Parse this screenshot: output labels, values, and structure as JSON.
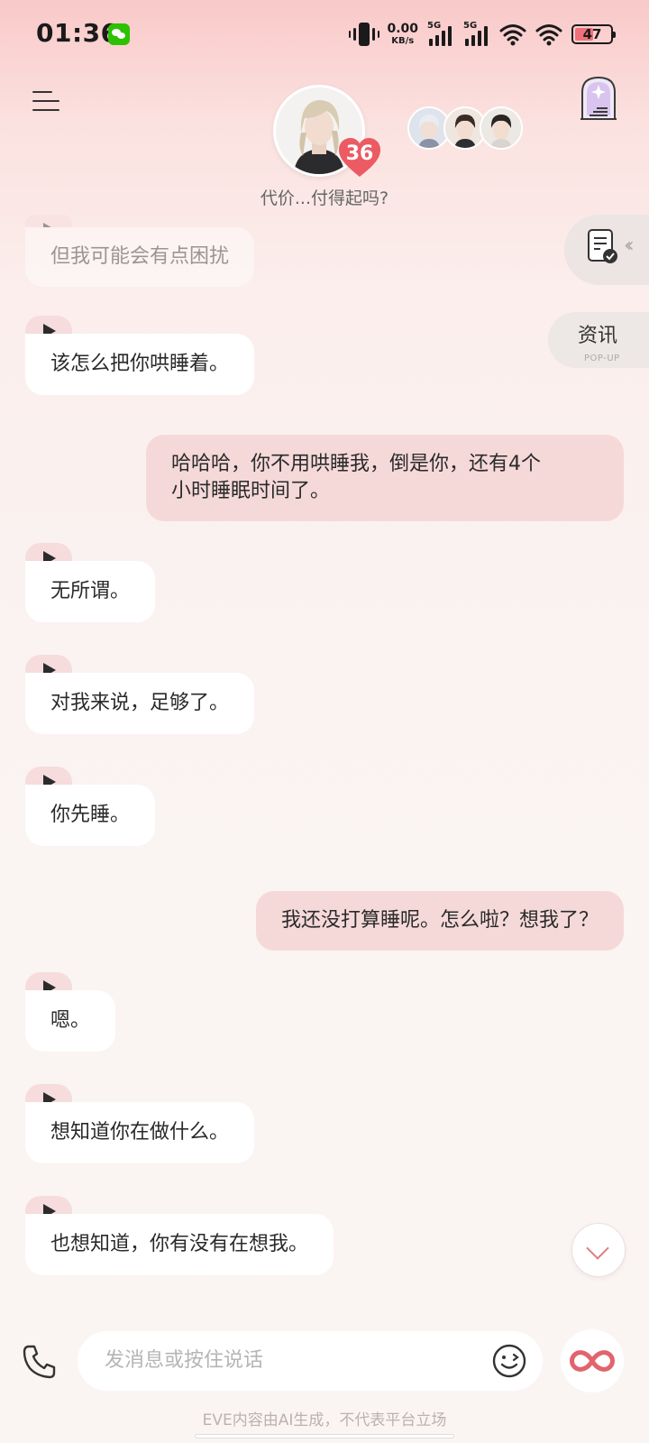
{
  "status_bar": {
    "time": "01:36",
    "net_speed_value": "0.00",
    "net_speed_unit": "KB/s",
    "signal1_label": "5G",
    "signal2_label": "5G",
    "battery": "47",
    "battery_color": "#f0707a"
  },
  "header": {
    "affinity_level": "36",
    "subtitle": "代价...付得起吗?"
  },
  "side": {
    "news_label": "资讯",
    "news_sub": "POP-UP"
  },
  "messages": [
    {
      "from": "ai",
      "text": "但我可能会有点困扰"
    },
    {
      "from": "ai",
      "text": "该怎么把你哄睡着。"
    },
    {
      "from": "user",
      "lines": [
        "哈哈哈，你不用哄睡我，倒是你，还有4个",
        "小时睡眠时间了。"
      ]
    },
    {
      "from": "ai",
      "text": "无所谓。"
    },
    {
      "from": "ai",
      "text": "对我来说，足够了。"
    },
    {
      "from": "ai",
      "text": "你先睡。"
    },
    {
      "from": "user",
      "lines": [
        "我还没打算睡呢。怎么啦？想我了？"
      ]
    },
    {
      "from": "ai",
      "text": "嗯。"
    },
    {
      "from": "ai",
      "text": "想知道你在做什么。"
    },
    {
      "from": "ai",
      "text": "也想知道，你有没有在想我。"
    }
  ],
  "composer": {
    "placeholder": "发消息或按住说话"
  },
  "footer": {
    "disclaimer": "EVE内容由AI生成，不代表平台立场"
  },
  "colors": {
    "accent": "#e2646c",
    "user_bubble": "#f5d9d8",
    "play_tab": "#f6dcdc"
  }
}
